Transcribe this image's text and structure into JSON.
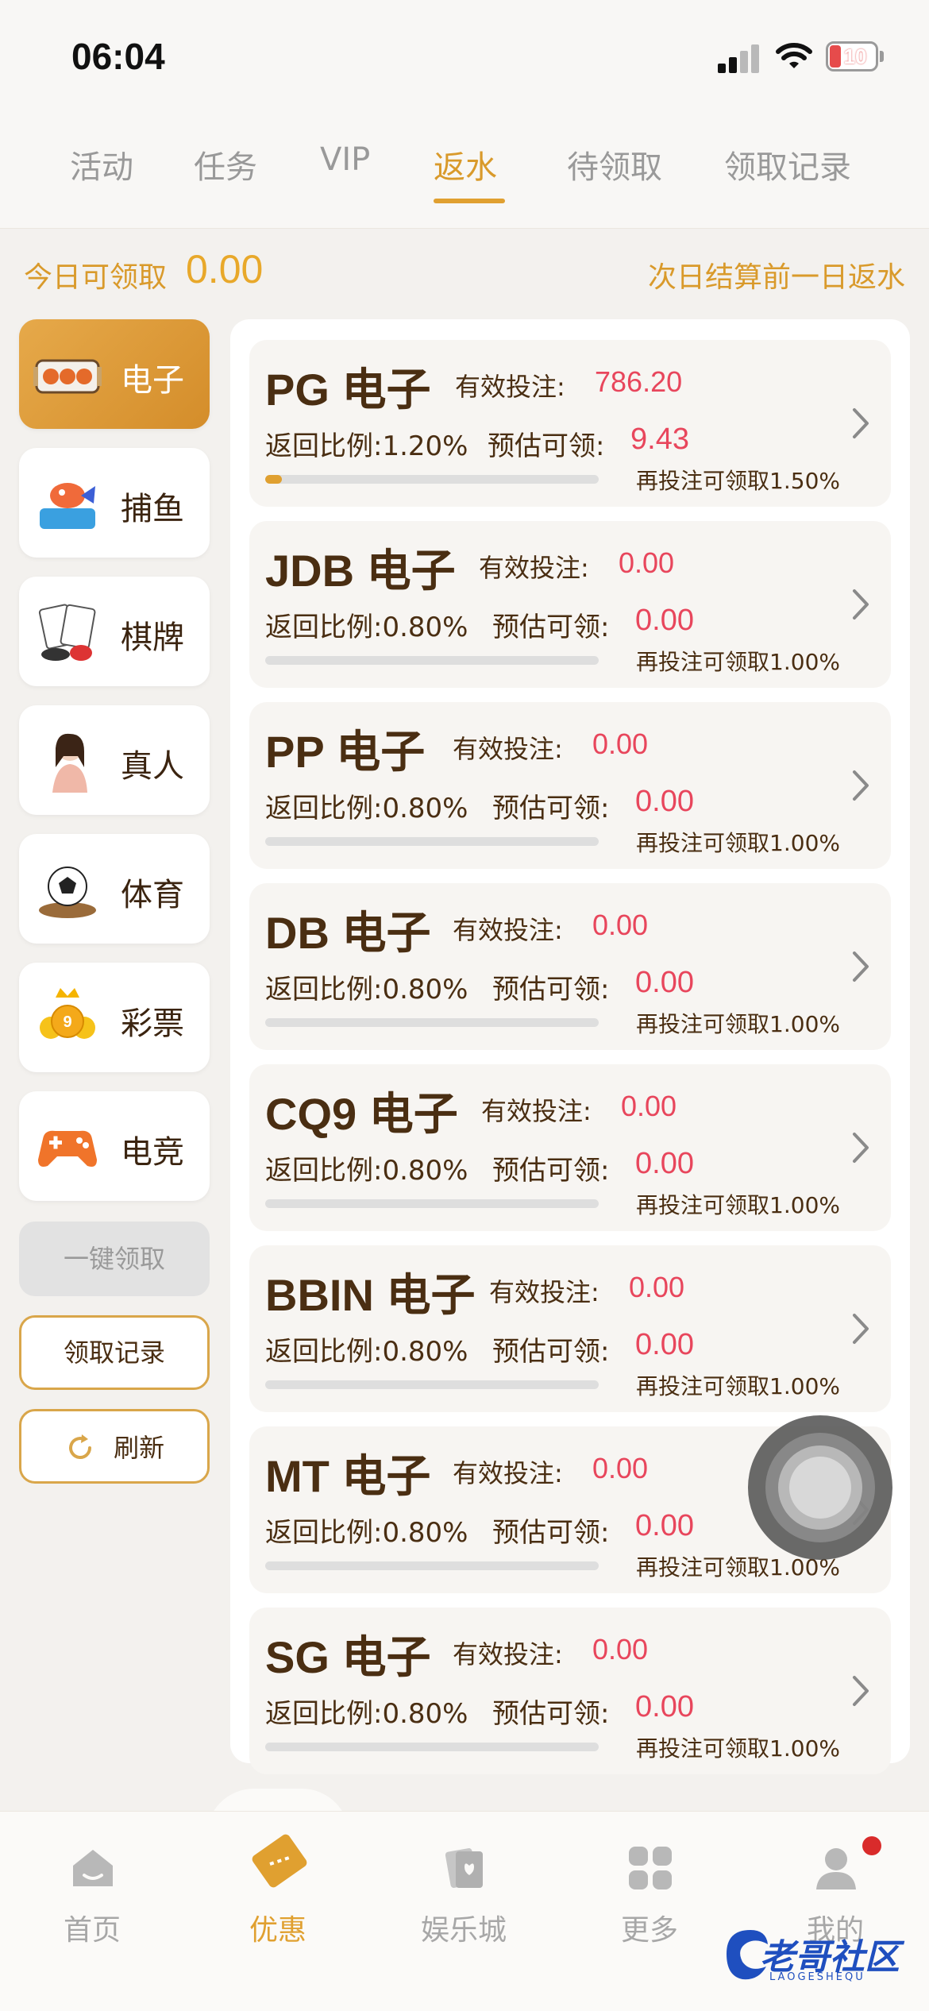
{
  "status_bar": {
    "time": "06:04",
    "battery": "10"
  },
  "tabs": [
    {
      "label": "活动",
      "active": false
    },
    {
      "label": "任务",
      "active": false
    },
    {
      "label": "VIP",
      "active": false
    },
    {
      "label": "返水",
      "active": true
    },
    {
      "label": "待领取",
      "active": false
    },
    {
      "label": "领取记录",
      "active": false
    }
  ],
  "summary": {
    "claim_label": "今日可领取",
    "claim_amount": "0.00",
    "settle_note": "次日结算前一日返水"
  },
  "categories": [
    {
      "label": "电子",
      "icon": "slot-machine-icon",
      "active": true
    },
    {
      "label": "捕鱼",
      "icon": "fish-icon",
      "active": false
    },
    {
      "label": "棋牌",
      "icon": "poker-cards-icon",
      "active": false
    },
    {
      "label": "真人",
      "icon": "live-dealer-icon",
      "active": false
    },
    {
      "label": "体育",
      "icon": "soccer-ball-icon",
      "active": false
    },
    {
      "label": "彩票",
      "icon": "lottery-balls-icon",
      "active": false
    },
    {
      "label": "电竞",
      "icon": "gamepad-icon",
      "active": false
    }
  ],
  "actions": {
    "one_click": "一键领取",
    "records": "领取记录",
    "refresh": "刷新"
  },
  "labels": {
    "bet": "有效投注:",
    "rate_prefix": "返回比例:",
    "estimate": "预估可领:",
    "next_prefix": "再投注可领取"
  },
  "games": [
    {
      "name": "PG",
      "suffix": "电子",
      "bet": "786.20",
      "rate": "1.20%",
      "estimate": "9.43",
      "next_rate": "1.50%",
      "progress": 0.05
    },
    {
      "name": "JDB",
      "suffix": "电子",
      "bet": "0.00",
      "rate": "0.80%",
      "estimate": "0.00",
      "next_rate": "1.00%",
      "progress": 0
    },
    {
      "name": "PP",
      "suffix": "电子",
      "bet": "0.00",
      "rate": "0.80%",
      "estimate": "0.00",
      "next_rate": "1.00%",
      "progress": 0
    },
    {
      "name": "DB",
      "suffix": "电子",
      "bet": "0.00",
      "rate": "0.80%",
      "estimate": "0.00",
      "next_rate": "1.00%",
      "progress": 0
    },
    {
      "name": "CQ9",
      "suffix": "电子",
      "bet": "0.00",
      "rate": "0.80%",
      "estimate": "0.00",
      "next_rate": "1.00%",
      "progress": 0
    },
    {
      "name": "BBIN",
      "suffix": "电子",
      "bet": "0.00",
      "rate": "0.80%",
      "estimate": "0.00",
      "next_rate": "1.00%",
      "progress": 0
    },
    {
      "name": "MT",
      "suffix": "电子",
      "bet": "0.00",
      "rate": "0.80%",
      "estimate": "0.00",
      "next_rate": "1.00%",
      "progress": 0
    },
    {
      "name": "SG",
      "suffix": "电子",
      "bet": "0.00",
      "rate": "0.80%",
      "estimate": "0.00",
      "next_rate": "1.00%",
      "progress": 0
    }
  ],
  "bottom_nav": [
    {
      "label": "首页",
      "icon": "home-icon",
      "active": false
    },
    {
      "label": "优惠",
      "icon": "ticket-icon",
      "active": true
    },
    {
      "label": "娱乐城",
      "icon": "cards-icon",
      "active": false
    },
    {
      "label": "更多",
      "icon": "grid-icon",
      "active": false
    },
    {
      "label": "我的",
      "icon": "user-icon",
      "active": false
    }
  ],
  "watermark": {
    "text": "老哥社区",
    "sub": "LAOGESHEQU"
  },
  "colors": {
    "accent": "#e0a030",
    "accent_text": "#d99a2b",
    "value_red": "#e8465c",
    "brown_text": "#4a2e12",
    "background": "#f3f1ee"
  }
}
